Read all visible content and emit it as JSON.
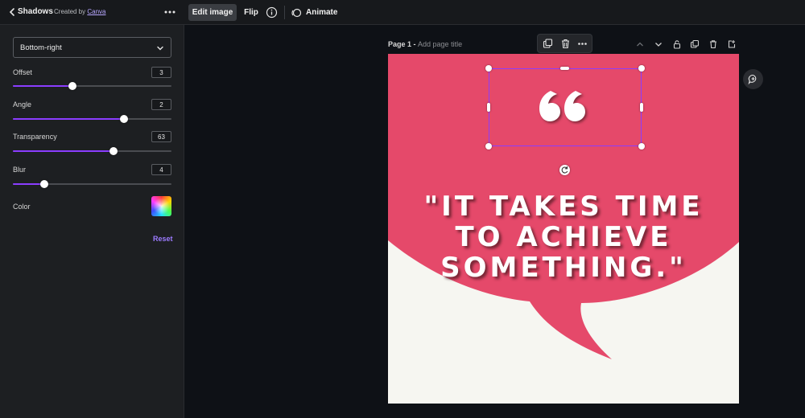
{
  "panel": {
    "title": "Shadows",
    "created_by_prefix": "Created by",
    "created_by_link": "Canva"
  },
  "toolbar": {
    "edit_image": "Edit image",
    "flip": "Flip",
    "animate": "Animate"
  },
  "shadow_settings": {
    "direction": "Bottom-right",
    "offset_label": "Offset",
    "offset_value": "3",
    "offset_fraction": 0.375,
    "angle_label": "Angle",
    "angle_value": "2",
    "angle_fraction": 0.7,
    "transparency_label": "Transparency",
    "transparency_value": "63",
    "transparency_fraction": 0.635,
    "blur_label": "Blur",
    "blur_value": "4",
    "blur_fraction": 0.2,
    "color_label": "Color",
    "reset_label": "Reset",
    "accent_color": "#8b3dff"
  },
  "page": {
    "label": "Page 1 -",
    "title_placeholder": "Add page title"
  },
  "design": {
    "quote_line1": "\"IT TAKES TIME",
    "quote_line2": "TO ACHIEVE",
    "quote_line3": "SOMETHING.\"",
    "bubble_color": "#e5496a",
    "background_color": "#f6f6f1"
  },
  "icons": {
    "back": "chevron-left-icon",
    "more": "more-horizontal-icon",
    "info": "info-icon",
    "animate": "animate-icon",
    "duplicate": "duplicate-icon",
    "delete": "trash-icon",
    "lock": "lock-icon",
    "add_page": "add-page-icon",
    "comment": "comment-icon"
  }
}
